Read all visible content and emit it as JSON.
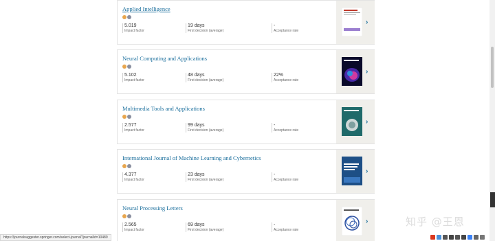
{
  "journals": [
    {
      "title": "Applied Intelligence",
      "impact_factor": "5.019",
      "impact_label": "Impact factor",
      "first_decision": "19 days",
      "first_decision_label": "First decision (average)",
      "acceptance": "-",
      "acceptance_label": "Acceptance rate"
    },
    {
      "title": "Neural Computing and Applications",
      "impact_factor": "5.102",
      "impact_label": "Impact factor",
      "first_decision": "48 days",
      "first_decision_label": "First decision (average)",
      "acceptance": "22%",
      "acceptance_label": "Acceptance rate"
    },
    {
      "title": "Multimedia Tools and Applications",
      "impact_factor": "2.577",
      "impact_label": "Impact factor",
      "first_decision": "99 days",
      "first_decision_label": "First decision (average)",
      "acceptance": "-",
      "acceptance_label": "Acceptance rate"
    },
    {
      "title": "International Journal of Machine Learning and Cybernetics",
      "impact_factor": "4.377",
      "impact_label": "Impact factor",
      "first_decision": "23 days",
      "first_decision_label": "First decision (average)",
      "acceptance": "-",
      "acceptance_label": "Acceptance rate"
    },
    {
      "title": "Neural Processing Letters",
      "impact_factor": "2.565",
      "impact_label": "Impact factor",
      "first_decision": "69 days",
      "first_decision_label": "First decision (average)",
      "acceptance": "-",
      "acceptance_label": "Acceptance rate"
    }
  ],
  "status_url": "https://journalsuggester.springer.com/select-journal?journalId=10489",
  "watermark": "知乎 @王恩",
  "colors": {
    "link": "#1a6e9c",
    "cover_panel": "#f0efeb",
    "border": "#e3e3e3"
  }
}
